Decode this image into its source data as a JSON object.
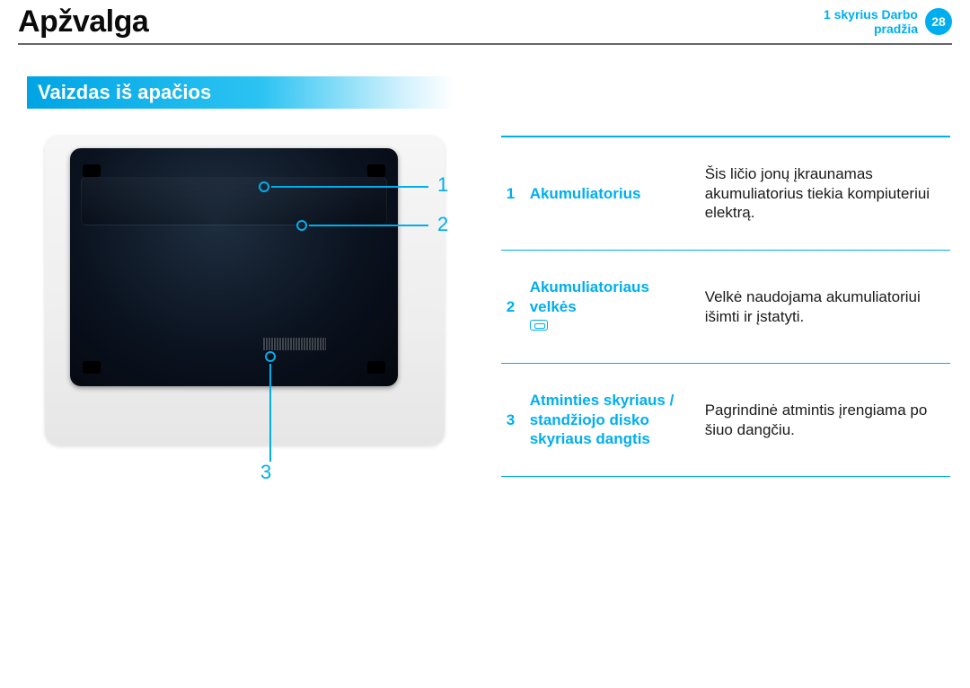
{
  "header": {
    "title": "Apžvalga",
    "chapter_line1": "1 skyrius Darbo",
    "chapter_line2": "pradžia",
    "page_number": "28"
  },
  "subheading": "Vaizdas iš apačios",
  "callouts": {
    "c1": "1",
    "c2": "2",
    "c3": "3"
  },
  "table": {
    "rows": [
      {
        "num": "1",
        "term": "Akumuliatorius",
        "desc": "Šis ličio jonų įkraunamas akumuliatorius tiekia kompiuteriui elektrą."
      },
      {
        "num": "2",
        "term": "Akumuliatoriaus velkės",
        "desc": "Velkė naudojama akumuliatoriui išimti ir įstatyti."
      },
      {
        "num": "3",
        "term": "Atminties skyriaus / standžiojo disko skyriaus dangtis",
        "desc": "Pagrindinė atmintis įrengiama po šiuo dangčiu."
      }
    ]
  }
}
